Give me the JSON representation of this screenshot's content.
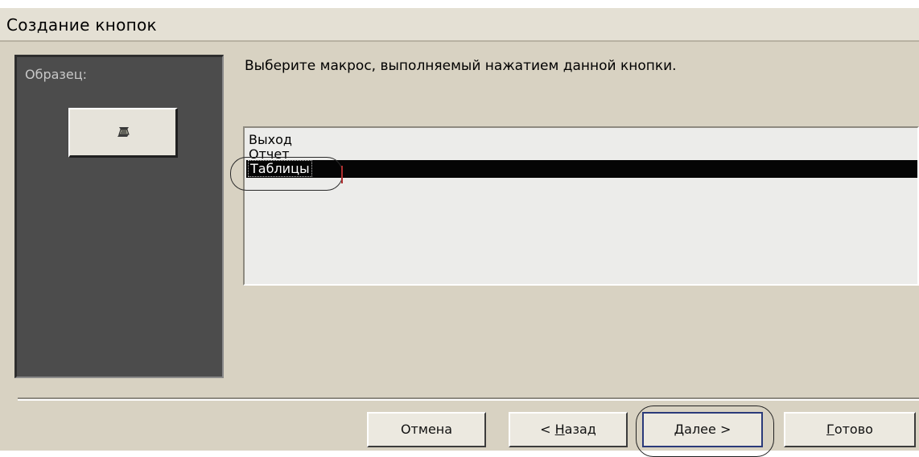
{
  "window": {
    "title": "Создание кнопок"
  },
  "preview": {
    "label": "Образец:",
    "sample_icon": "macro-scroll-icon"
  },
  "main": {
    "instruction": "Выберите макрос, выполняемый нажатием данной кнопки.",
    "macros": [
      {
        "label": "Выход",
        "selected": false
      },
      {
        "label": "Отчет",
        "selected": false
      },
      {
        "label": "Таблицы",
        "selected": true
      }
    ]
  },
  "buttons": {
    "cancel": "Отмена",
    "back_prefix": "< ",
    "back_hotkey": "Н",
    "back_rest": "азад",
    "next_hotkey": "Д",
    "next_rest": "алее >",
    "finish_hotkey": "Г",
    "finish_rest": "отово"
  },
  "colors": {
    "dialog_bg": "#d8d2c2",
    "preview_bg": "#4c4c4c",
    "selection_bg": "#050505",
    "selection_text": "#ffffff"
  }
}
